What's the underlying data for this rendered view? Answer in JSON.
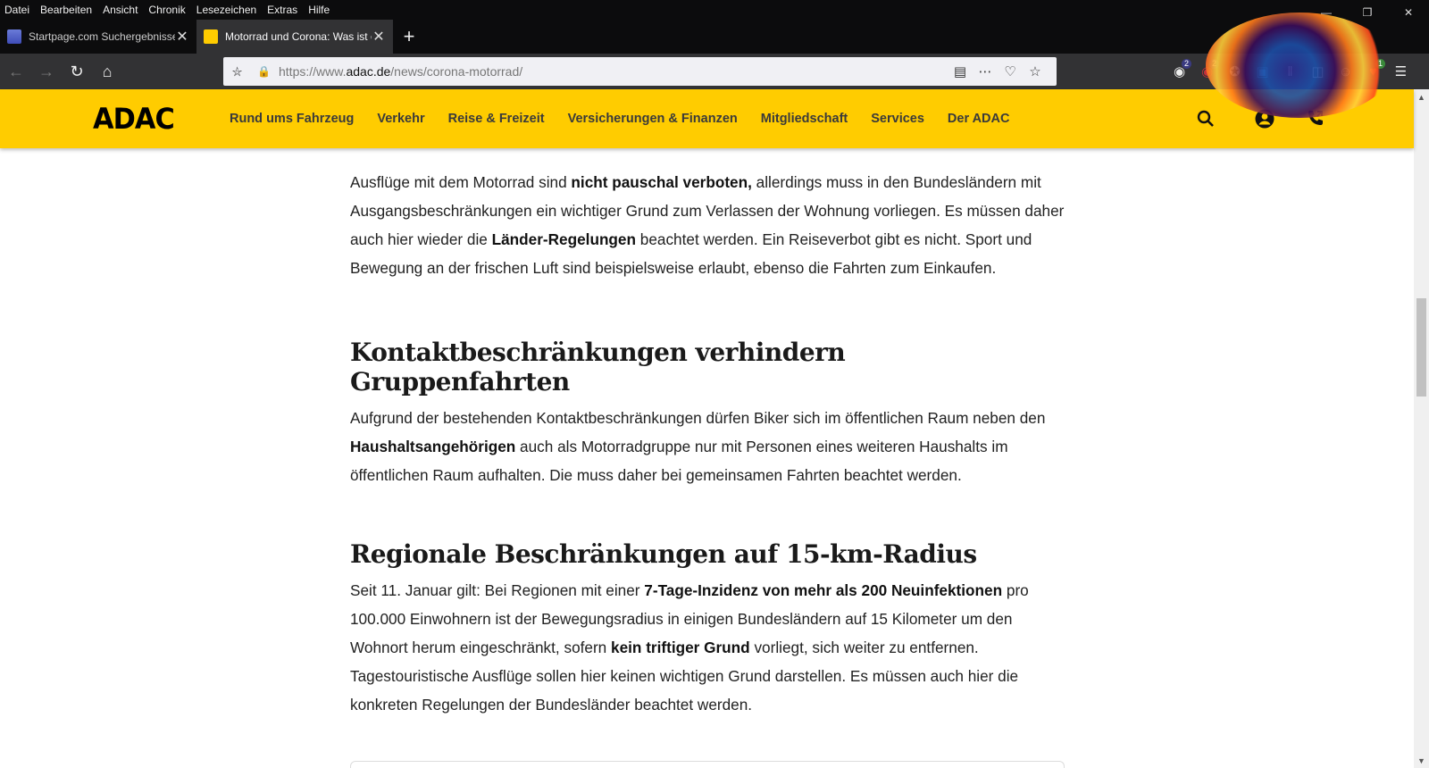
{
  "menubar": {
    "items": [
      "Datei",
      "Bearbeiten",
      "Ansicht",
      "Chronik",
      "Lesezeichen",
      "Extras",
      "Hilfe"
    ]
  },
  "tabs": [
    {
      "title": "Startpage.com Suchergebnisse",
      "active": false
    },
    {
      "title": "Motorrad und Corona: Was ist erlaubt?",
      "active": true
    }
  ],
  "urlbar": {
    "url_prefix": "https://www.",
    "url_domain": "adac.de",
    "url_path": "/news/corona-motorrad/"
  },
  "extensions": {
    "badge_1": "2",
    "badge_2": "2",
    "badge_3": "1"
  },
  "site": {
    "logo": "ADAC",
    "nav": [
      "Rund ums Fahrzeug",
      "Verkehr",
      "Reise & Freizeit",
      "Versicherungen & Finanzen",
      "Mitgliedschaft",
      "Services",
      "Der ADAC"
    ],
    "brand_color": "#ffcc00"
  },
  "article": {
    "p1": {
      "t1": "Ausflüge mit dem Motorrad sind ",
      "b1": "nicht pauschal verboten,",
      "t2": " allerdings muss in den Bundesländern mit Ausgangsbeschränkungen ein wichtiger Grund zum Verlassen der Wohnung vorliegen. Es müssen daher auch hier wieder die ",
      "b2": "Länder-Regelungen",
      "t3": " beachtet werden. Ein Reiseverbot gibt es nicht. Sport und Bewegung an der frischen Luft sind beispielsweise erlaubt, ebenso die Fahrten zum Einkaufen."
    },
    "h2_1": "Kontaktbeschränkungen verhindern Gruppenfahrten",
    "p2": {
      "t1": "Aufgrund der bestehenden Kontaktbeschränkungen dürfen Biker sich im öffentlichen Raum neben den ",
      "b1": "Haushaltsangehörigen",
      "t2": " auch als Motorradgruppe nur mit Personen eines weiteren Haushalts im öffentlichen Raum aufhalten. Die muss daher bei gemeinsamen Fahrten beachtet werden."
    },
    "h2_2": "Regionale Beschränkungen auf 15-km-Radius",
    "p3": {
      "t1": "Seit 11. Januar gilt: Bei Regionen mit einer ",
      "b1": "7-Tage-Inzidenz von mehr als 200 Neuinfektionen",
      "t2": " pro 100.000 Einwohnern ist der Bewegungsradius in einigen Bundesländern auf 15 Kilometer um den Wohnort herum eingeschränkt, sofern ",
      "b2": "kein triftiger Grund",
      "t3": " vorliegt, sich weiter zu entfernen. Tagestouristische Ausflüge sollen hier keinen wichtigen Grund darstellen. Es müssen auch hier die konkreten Regelungen der Bundesländer beachtet werden."
    }
  }
}
